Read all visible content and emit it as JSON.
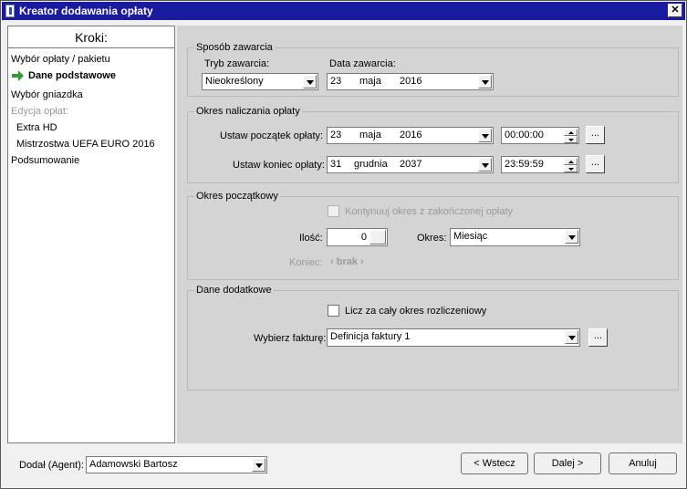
{
  "window": {
    "title": "Kreator dodawania opłaty",
    "close_glyph": "✕"
  },
  "sidebar": {
    "heading": "Kroki:",
    "steps": [
      "Wybór opłaty / pakietu",
      "Dane podstawowe",
      "Wybór gniazdka",
      "Edycja opłat:",
      "Extra HD",
      "Mistrzostwa UEFA EURO 2016",
      "Podsumowanie"
    ]
  },
  "sposob": {
    "legend": "Sposób zawarcia",
    "tryb_label": "Tryb zawarcia:",
    "tryb_value": "Nieokreślony",
    "data_label": "Data zawarcia:",
    "data_day": "23",
    "data_month": "maja",
    "data_year": "2016"
  },
  "okres": {
    "legend": "Okres naliczania opłaty",
    "start_label": "Ustaw początek opłaty:",
    "start_day": "23",
    "start_month": "maja",
    "start_year": "2016",
    "start_time": "00:00:00",
    "end_label": "Ustaw koniec opłaty:",
    "end_day": "31",
    "end_month": "grudnia",
    "end_year": "2037",
    "end_time": "23:59:59",
    "dots": "..."
  },
  "poczatkowy": {
    "legend": "Okres początkowy",
    "kontynuuj_label": "Kontynuuj okres z zakończonej opłaty",
    "ilosc_label": "Ilość:",
    "ilosc_value": "0",
    "okres_label": "Okres:",
    "okres_value": "Miesiąc",
    "koniec_label": "Koniec:",
    "koniec_value": "‹ brak ›"
  },
  "dodatkowe": {
    "legend": "Dane dodatkowe",
    "licz_label": "Licz za cały okres rozliczeniowy",
    "faktura_label": "Wybierz fakturę:",
    "faktura_value": "Definicja faktury 1",
    "dots": "..."
  },
  "footer": {
    "agent_label": "Dodał (Agent):",
    "agent_value": "Adamowski Bartosz",
    "back": "< Wstecz",
    "next": "Dalej >",
    "cancel": "Anuluj"
  },
  "colors": {
    "titlebar": "#1a1aa0",
    "arrow": "#2e9e2e"
  }
}
